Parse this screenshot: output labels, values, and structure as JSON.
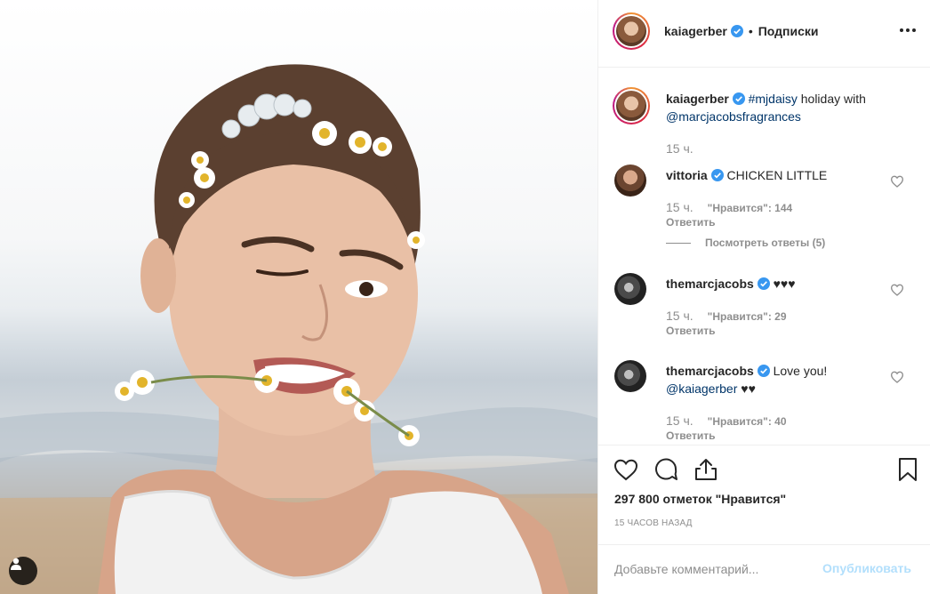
{
  "post": {
    "author": "kaiagerber",
    "follow_label": "Подписки",
    "separator": "•"
  },
  "caption": {
    "author": "kaiagerber",
    "hashtag": "#mjdaisy",
    "text": " holiday with ",
    "mention": "@marcjacobsfragrances",
    "time": "15 ч."
  },
  "comments": [
    {
      "author": "vittoria",
      "text": "CHICKEN LITTLE",
      "time": "15 ч.",
      "likes": "\"Нравится\": 144",
      "reply_label": "Ответить",
      "view_replies": "Посмотреть ответы (5)"
    },
    {
      "author": "themarcjacobs",
      "text": "♥♥♥",
      "time": "15 ч.",
      "likes": "\"Нравится\": 29",
      "reply_label": "Ответить"
    },
    {
      "author": "themarcjacobs",
      "text": "Love you!",
      "mention": "@kaiagerber",
      "text_after": " ♥♥",
      "time": "15 ч.",
      "likes": "\"Нравится\": 40",
      "reply_label": "Ответить"
    }
  ],
  "footer": {
    "likes_total": "297 800 отметок \"Нравится\"",
    "post_time": "15 часов назад"
  },
  "add_comment": {
    "placeholder": "Добавьте комментарий...",
    "publish_label": "Опубликовать"
  },
  "icons": {
    "verified": "verified-badge-icon",
    "like": "heart-icon",
    "comment": "comment-bubble-icon",
    "share": "share-icon",
    "save": "bookmark-icon",
    "more": "more-dots-icon",
    "tag": "user-tag-icon"
  },
  "colors": {
    "verified_blue": "#3897f0",
    "link": "#003569",
    "muted": "#8e8e8e",
    "publish_disabled": "#b2dffc"
  }
}
